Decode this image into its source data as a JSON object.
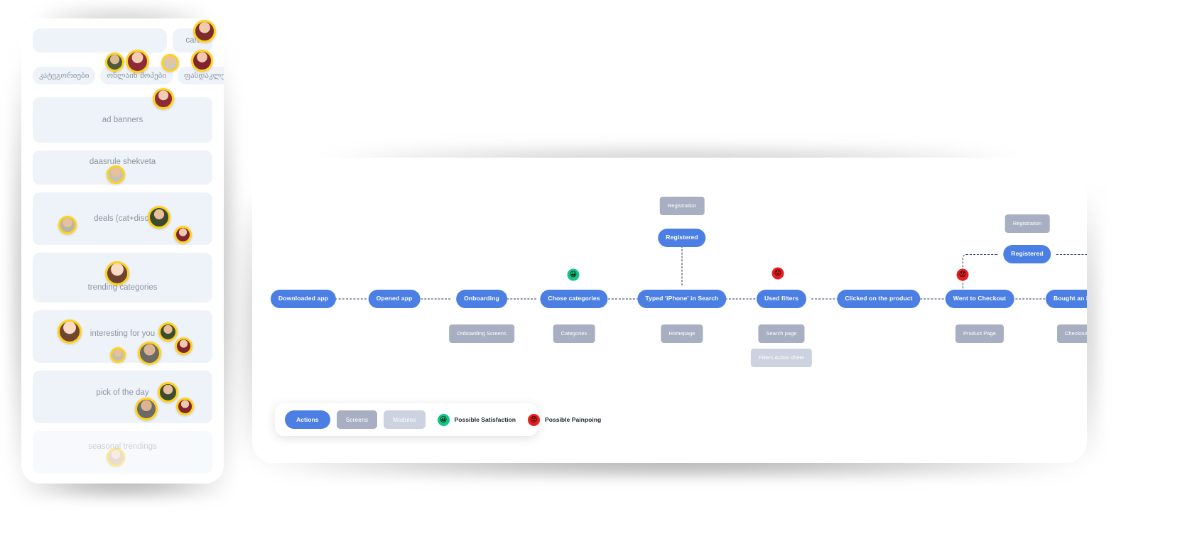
{
  "phone": {
    "search_placeholder": "",
    "cart_label": "cart",
    "chips": [
      {
        "label": "კატეგორიები"
      },
      {
        "label": "ონლაინ შოპები"
      },
      {
        "label": "ფასდაკლებები"
      }
    ],
    "cards": [
      {
        "label": "ad banners"
      },
      {
        "label": "daasrule shekveta"
      },
      {
        "label": "deals (cat+disc)"
      },
      {
        "label": "trending categories"
      },
      {
        "label": "interesting for you"
      },
      {
        "label": "pick of the day"
      },
      {
        "label": "seasonal trendings"
      }
    ]
  },
  "board": {
    "actions": [
      {
        "id": "downloaded-app",
        "label": "Downloaded app"
      },
      {
        "id": "opened-app",
        "label": "Opened app"
      },
      {
        "id": "onboarding",
        "label": "Onboarding"
      },
      {
        "id": "chose-categories",
        "label": "Chose categories"
      },
      {
        "id": "typed-iphone",
        "label": "Typed 'iPhone' in Search"
      },
      {
        "id": "used-filters",
        "label": "Used filters"
      },
      {
        "id": "clicked-product",
        "label": "Clicked on the product"
      },
      {
        "id": "went-checkout",
        "label": "Went to Checkout"
      },
      {
        "id": "bought-item",
        "label": "Bought an item"
      }
    ],
    "branch_actions": [
      {
        "id": "registered-mid",
        "label": "Registered"
      },
      {
        "id": "registered-right",
        "label": "Registered"
      }
    ],
    "screens": [
      {
        "id": "onboarding-screens",
        "label": "Onboarding Screens"
      },
      {
        "id": "categories",
        "label": "Categories"
      },
      {
        "id": "homepage",
        "label": "Homepage"
      },
      {
        "id": "search-page",
        "label": "Search page"
      },
      {
        "id": "product-page",
        "label": "Product Page"
      },
      {
        "id": "checkout",
        "label": "Checkout"
      },
      {
        "id": "registration-mid",
        "label": "Registration"
      },
      {
        "id": "registration-right",
        "label": "Registration"
      }
    ],
    "modules": [
      {
        "id": "filters-action-sheet",
        "label": "Filters Action sheet"
      }
    ],
    "markers": [
      {
        "id": "satisfaction-categories",
        "kind": "satisfaction",
        "glyph": "😀"
      },
      {
        "id": "painpoint-filters",
        "kind": "painpoint",
        "glyph": "😟"
      },
      {
        "id": "painpoint-checkout",
        "kind": "painpoint",
        "glyph": "😟"
      }
    ]
  },
  "legend": {
    "actions_label": "Actions",
    "screens_label": "Screens",
    "modules_label": "Modules",
    "satisfaction_label": "Possible Satisfaction",
    "painpoint_label": "Possible Painpoing",
    "satisfaction_glyph": "😀",
    "painpoint_glyph": "😟"
  },
  "colors": {
    "action_blue": "#4b7fe3",
    "screen_gray": "#a8afc2",
    "module_gray": "#ccd2e0",
    "satisfaction_green": "#12c583",
    "painpoint_red": "#e3201f",
    "avatar_ring": "#ffd21a",
    "phone_block": "#eef3fa"
  }
}
